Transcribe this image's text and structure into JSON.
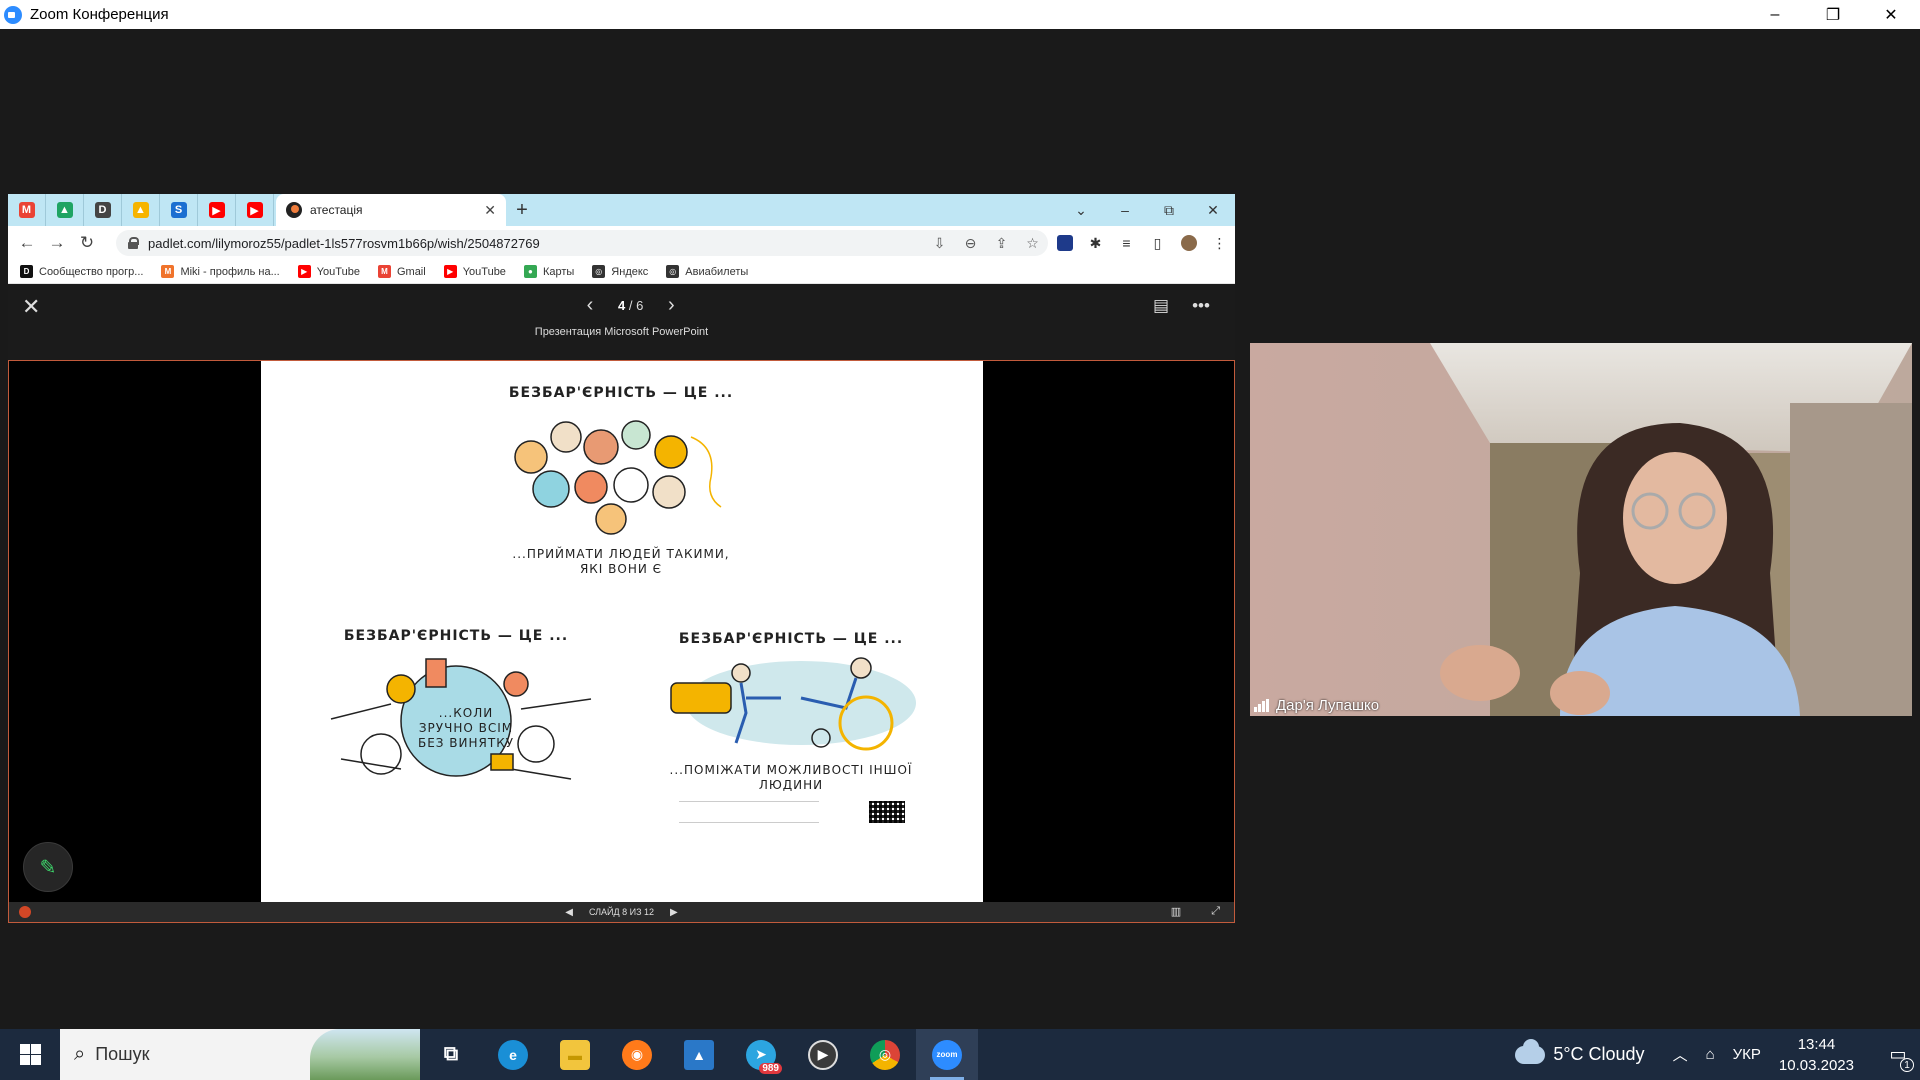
{
  "zoom": {
    "title": "Zoom Конференция",
    "minimize": "–",
    "restore": "❐",
    "close": "✕"
  },
  "browser": {
    "pinned_tabs": [
      {
        "name": "gmail",
        "glyph": "M",
        "color": "#ea4335"
      },
      {
        "name": "drive",
        "glyph": "▲",
        "color": "#1fa463"
      },
      {
        "name": "d-app",
        "glyph": "D",
        "color": "#444444"
      },
      {
        "name": "warning-app",
        "glyph": "▲",
        "color": "#f6b400"
      },
      {
        "name": "s-app",
        "glyph": "S",
        "color": "#1b6fd1"
      },
      {
        "name": "youtube-1",
        "glyph": "▶",
        "color": "#ff0000"
      },
      {
        "name": "youtube-2",
        "glyph": "▶",
        "color": "#ff0000"
      }
    ],
    "active_tab_title": "атестація",
    "tab_close": "✕",
    "new_tab": "+",
    "tab_dropdown": "⌄",
    "win_min": "–",
    "win_restore": "⧉",
    "win_close": "✕",
    "back": "←",
    "forward": "→",
    "reload": "↻",
    "url": "padlet.com/lilymoroz55/padlet-1ls577rosvm1b66p/wish/2504872769",
    "bookmarks": [
      {
        "label": "Сообщество прогр...",
        "glyph": "D",
        "color": "#111111"
      },
      {
        "label": "Miki - профиль на...",
        "glyph": "M",
        "color": "#f0732b"
      },
      {
        "label": "YouTube",
        "glyph": "▶",
        "color": "#ff0000"
      },
      {
        "label": "Gmail",
        "glyph": "M",
        "color": "#ea4335"
      },
      {
        "label": "YouTube",
        "glyph": "▶",
        "color": "#ff0000"
      },
      {
        "label": "Карты",
        "glyph": "●",
        "color": "#34a853"
      },
      {
        "label": "Яндекс",
        "glyph": "◎",
        "color": "#333333"
      },
      {
        "label": "Авиабилеты",
        "glyph": "◎",
        "color": "#333333"
      }
    ]
  },
  "viewer": {
    "close": "✕",
    "prev": "‹",
    "next": "›",
    "page_current": "4",
    "page_total": "/ 6",
    "caption": "Презентация Microsoft PowerPoint",
    "notes_icon": "▤",
    "more_icon": "•••"
  },
  "slide": {
    "top_title": "БЕЗБАР'ЄРНІСТЬ — ЦЕ ...",
    "top_sub": "...ПРИЙМАТИ ЛЮДЕЙ ТАКИМИ, ЯКІ ВОНИ Є",
    "left_title": "БЕЗБАР'ЄРНІСТЬ — ЦЕ ...",
    "left_sub": "...КОЛИ ЗРУЧНО ВСІМ БЕЗ ВИНЯТКУ",
    "right_title": "БЕЗБАР'ЄРНІСТЬ — ЦЕ ...",
    "right_sub": "...ПОМІЖАТИ МОЖЛИВОСТІ ІНШОЇ ЛЮДИНИ"
  },
  "ppt_bar": {
    "prev": "◀",
    "status": "СЛАЙД 8 ИЗ 12",
    "next": "▶",
    "view_icon": "▥",
    "fullscreen_icon": "⤢"
  },
  "video": {
    "participant_name": "Дар'я Лупашко"
  },
  "taskbar": {
    "search_placeholder": "Пошук",
    "apps": [
      {
        "name": "task-view",
        "glyph": "⧉",
        "color": "transparent"
      },
      {
        "name": "edge",
        "glyph": "e",
        "color": "#1a8fd6"
      },
      {
        "name": "file-explorer",
        "glyph": "▬",
        "color": "#f2c53d"
      },
      {
        "name": "firefox",
        "glyph": "◉",
        "color": "#ff7a1a"
      },
      {
        "name": "photos",
        "glyph": "▲",
        "color": "#2a78c8"
      },
      {
        "name": "telegram",
        "glyph": "➤",
        "color": "#2ca5e0",
        "badge": "989"
      },
      {
        "name": "media-player",
        "glyph": "▶",
        "color": "#3a3a3a"
      },
      {
        "name": "chrome",
        "glyph": "◎",
        "color": "#db4437"
      },
      {
        "name": "zoom",
        "glyph": "zoom",
        "color": "#2d8cff",
        "active": true
      }
    ],
    "weather": "5°C  Cloudy",
    "tray_chevron": "︿",
    "tray_camera": "⌂",
    "language": "УКР",
    "time": "13:44",
    "date": "10.03.2023",
    "notifications": "1"
  }
}
